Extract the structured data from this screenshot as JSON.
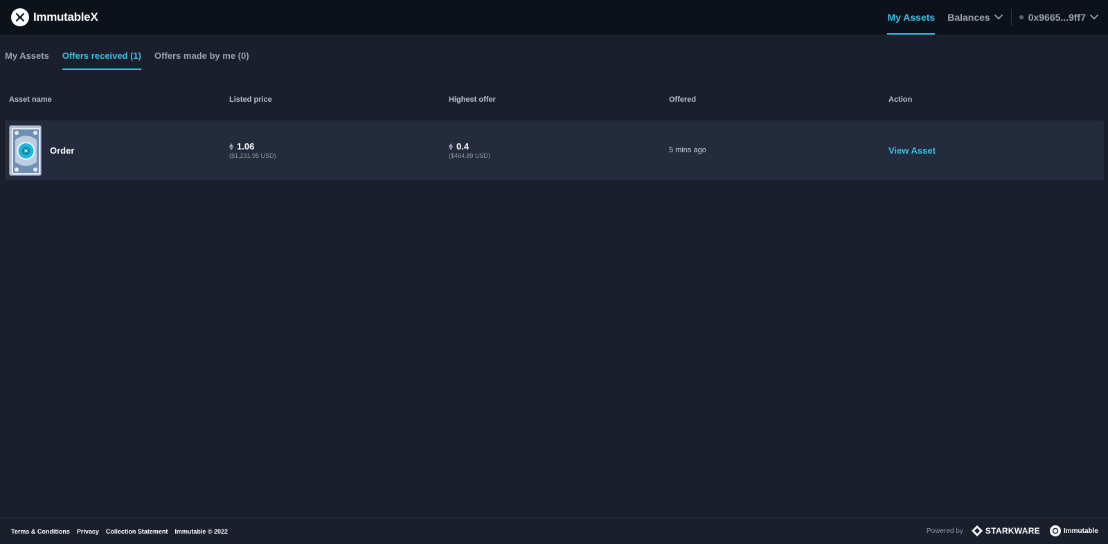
{
  "header": {
    "brand": "ImmutableX",
    "nav_my_assets": "My Assets",
    "nav_balances": "Balances",
    "wallet": "0x9665...9ff7"
  },
  "tabs": [
    {
      "label": "My Assets",
      "active": false
    },
    {
      "label": "Offers received (1)",
      "active": true
    },
    {
      "label": "Offers made by me (0)",
      "active": false
    }
  ],
  "table": {
    "columns": [
      "Asset name",
      "Listed price",
      "Highest offer",
      "Offered",
      "Action"
    ],
    "rows": [
      {
        "asset_name": "Order",
        "listed_price": "1.06",
        "listed_price_usd": "($1,231.95 USD)",
        "highest_offer": "0.4",
        "highest_offer_usd": "($464.89 USD)",
        "offered": "5 mins ago",
        "action": "View Asset"
      }
    ]
  },
  "footer": {
    "links": [
      "Terms & Conditions",
      "Privacy",
      "Collection Statement",
      "Immutable © 2022"
    ],
    "powered_by": "Powered by",
    "starkware": "STARKWARE",
    "immutable": "Immutable"
  },
  "colors": {
    "accent": "#35c3e6",
    "header_bg": "#0d1119",
    "page_bg": "#1a1f2b",
    "row_bg": "#232b3d"
  }
}
